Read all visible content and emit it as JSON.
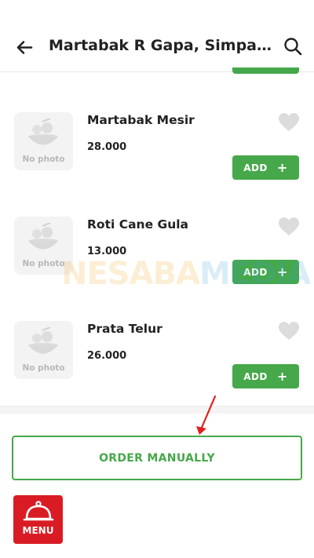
{
  "app_bar": {
    "title": "Martabak R Gapa, Simpang S...",
    "back_icon": "arrow-left-icon",
    "search_icon": "search-icon"
  },
  "items": [
    {
      "name": "Martabak Mesir",
      "price": "28.000",
      "photo_placeholder": "No photo",
      "add_label": "ADD",
      "add_icon": "+"
    },
    {
      "name": "Roti Cane Gula",
      "price": "13.000",
      "photo_placeholder": "No photo",
      "add_label": "ADD",
      "add_icon": "+"
    },
    {
      "name": "Prata Telur",
      "price": "26.000",
      "photo_placeholder": "No photo",
      "add_label": "ADD",
      "add_icon": "+"
    }
  ],
  "watermark": {
    "part1": "NESABA",
    "part2": "MEDIA"
  },
  "order_manually": {
    "label": "ORDER MANUALLY"
  },
  "menu_button": {
    "label": "MENU",
    "icon": "cloche-icon"
  },
  "colors": {
    "accent_green": "#46a84a",
    "menu_red": "#d91c24",
    "annotation_arrow": "#e0201e"
  }
}
